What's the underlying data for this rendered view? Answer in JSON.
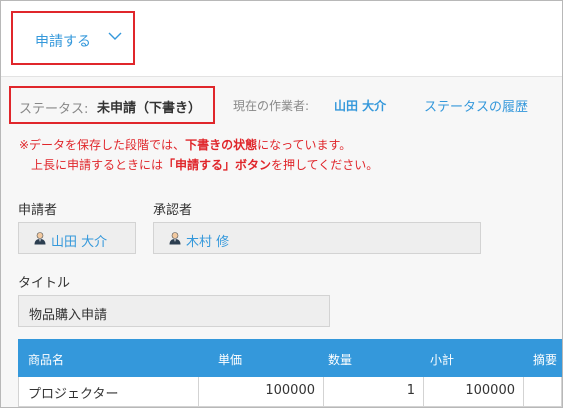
{
  "toolbar": {
    "apply_label": "申請する"
  },
  "status": {
    "label": "ステータス:",
    "value": "未申請（下書き）",
    "worker_label": "現在の作業者:",
    "worker_name": "山田 大介",
    "history_link": "ステータスの履歴"
  },
  "notice": {
    "line1_a": "※データを保存した段階では、",
    "line1_b": "下書きの状態",
    "line1_c": "になっています。",
    "line2_a": "上長に申請するときには",
    "line2_b": "「申請する」ボタン",
    "line2_c": "を押してください。"
  },
  "form": {
    "applicant_label": "申請者",
    "applicant_name": "山田 大介",
    "approver_label": "承認者",
    "approver_name": "木村 修",
    "title_label": "タイトル",
    "title_value": "物品購入申請"
  },
  "table": {
    "headers": [
      "商品名",
      "単価",
      "数量",
      "小計",
      "摘要"
    ],
    "rows": [
      [
        "プロジェクター",
        "100000",
        "1",
        "100000",
        ""
      ]
    ]
  },
  "colors": {
    "accent": "#3498db",
    "highlight_border": "#e0262b",
    "notice_text": "#e0262b"
  }
}
